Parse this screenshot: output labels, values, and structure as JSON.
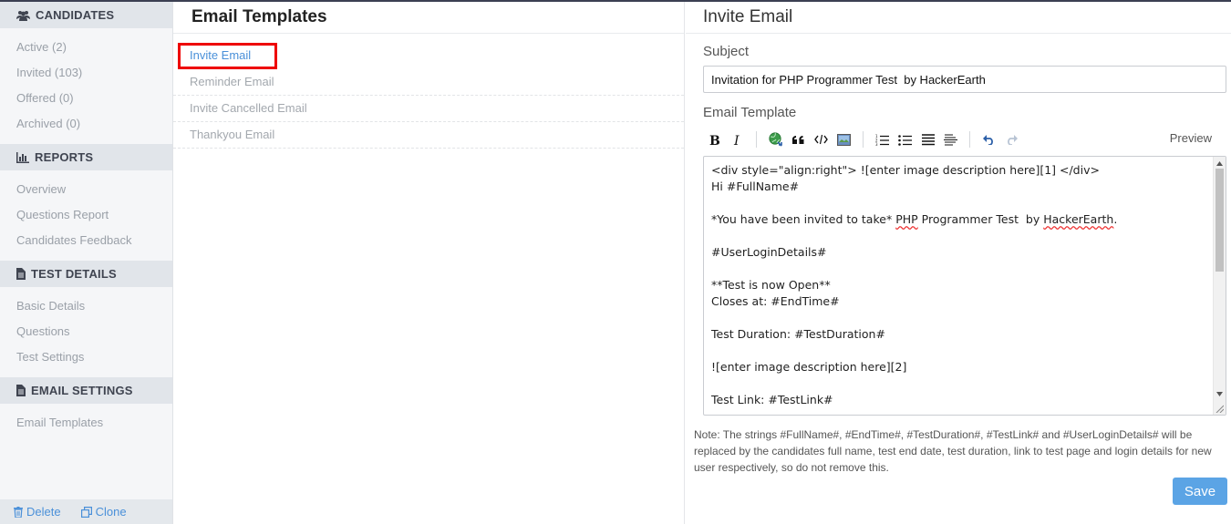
{
  "sidebar": {
    "sections": [
      {
        "title": "CANDIDATES",
        "icon": "users-icon",
        "items": [
          "Active (2)",
          "Invited (103)",
          "Offered (0)",
          "Archived (0)"
        ]
      },
      {
        "title": "REPORTS",
        "icon": "bar-chart-icon",
        "items": [
          "Overview",
          "Questions Report",
          "Candidates Feedback"
        ]
      },
      {
        "title": "TEST DETAILS",
        "icon": "document-icon",
        "items": [
          "Basic Details",
          "Questions",
          "Test Settings"
        ]
      },
      {
        "title": "EMAIL SETTINGS",
        "icon": "document-icon",
        "items": [
          "Email Templates"
        ]
      }
    ],
    "footer": {
      "delete_label": "Delete",
      "clone_label": "Clone"
    }
  },
  "templates": {
    "title": "Email Templates",
    "items": [
      "Invite Email",
      "Reminder Email",
      "Invite Cancelled Email",
      "Thankyou Email"
    ],
    "active_index": 0
  },
  "editor_panel": {
    "title": "Invite Email",
    "subject_label": "Subject",
    "subject_value": "Invitation for PHP Programmer Test  by HackerEarth",
    "template_label": "Email Template",
    "preview_label": "Preview",
    "lines": {
      "l1": "<div style=\"align:right\"> ![enter image description here][1] </div>",
      "l2": "Hi #FullName#",
      "l3a": "*You have been invited to take* ",
      "l3b": "PHP",
      "l3c": " Programmer Test  by ",
      "l3d": "HackerEarth",
      "l3e": ".",
      "l4": "#UserLoginDetails#",
      "l5": "**Test is now Open**",
      "l6": "Closes at: #EndTime#",
      "l7": "Test Duration: #TestDuration#",
      "l8": "![enter image description here][2]",
      "l9": "Test Link: #TestLink#"
    },
    "note": "Note: The strings #FullName#, #EndTime#, #TestDuration#, #TestLink# and #UserLoginDetails# will be replaced by the candidates full name, test end date, test duration, link to test page and login details for new user respectively, so do not remove this.",
    "save_label": "Save"
  },
  "colors": {
    "accent": "#4a90d9",
    "save_button": "#5ba4e5",
    "highlight_box": "#e00000"
  }
}
